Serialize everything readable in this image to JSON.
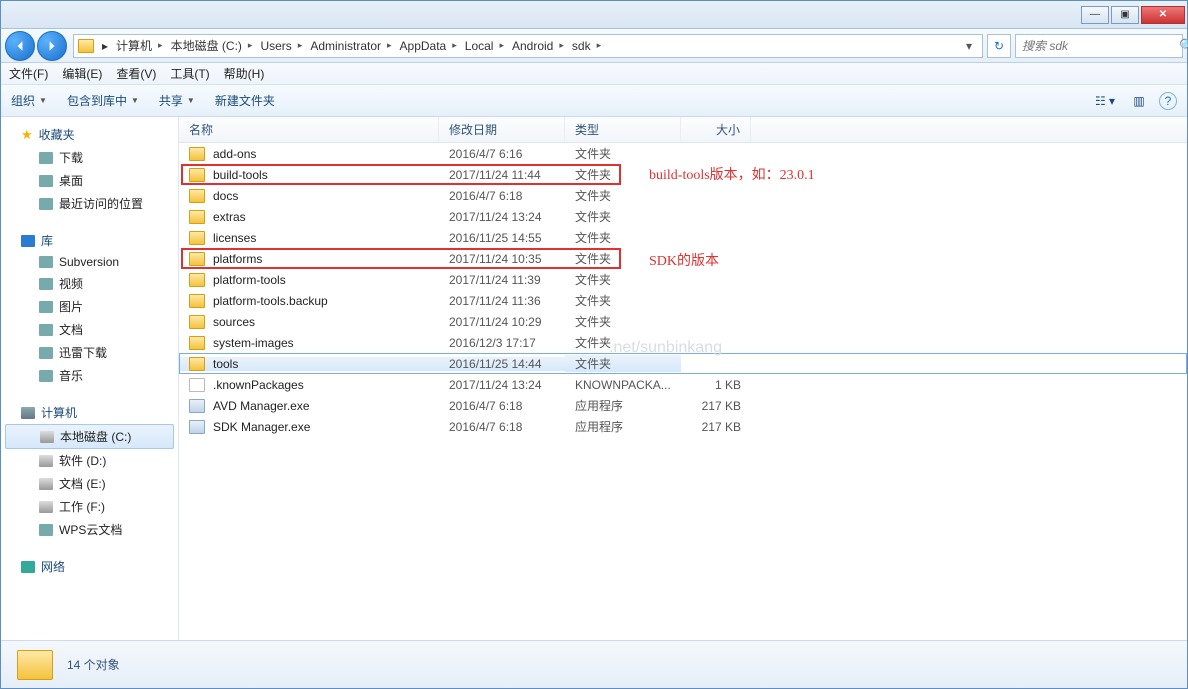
{
  "titlebar": {
    "min": "—",
    "max": "▣",
    "close": "✕"
  },
  "breadcrumb": [
    "计算机",
    "本地磁盘 (C:)",
    "Users",
    "Administrator",
    "AppData",
    "Local",
    "Android",
    "sdk"
  ],
  "search_placeholder": "搜索 sdk",
  "menubar": [
    "文件(F)",
    "编辑(E)",
    "查看(V)",
    "工具(T)",
    "帮助(H)"
  ],
  "toolbar": {
    "organize": "组织",
    "include": "包含到库中",
    "share": "共享",
    "newfolder": "新建文件夹"
  },
  "sidebar": {
    "favorites": {
      "label": "收藏夹",
      "items": [
        "下载",
        "桌面",
        "最近访问的位置"
      ]
    },
    "library": {
      "label": "库",
      "items": [
        "Subversion",
        "视频",
        "图片",
        "文档",
        "迅雷下载",
        "音乐"
      ]
    },
    "computer": {
      "label": "计算机",
      "items": [
        "本地磁盘 (C:)",
        "软件 (D:)",
        "文档 (E:)",
        "工作 (F:)",
        "WPS云文档"
      ],
      "selected": 0
    },
    "network": {
      "label": "网络"
    }
  },
  "columns": {
    "name": "名称",
    "date": "修改日期",
    "type": "类型",
    "size": "大小"
  },
  "files": [
    {
      "icon": "folder",
      "name": "add-ons",
      "date": "2016/4/7 6:16",
      "type": "文件夹",
      "size": ""
    },
    {
      "icon": "folder",
      "name": "build-tools",
      "date": "2017/11/24 11:44",
      "type": "文件夹",
      "size": ""
    },
    {
      "icon": "folder",
      "name": "docs",
      "date": "2016/4/7 6:18",
      "type": "文件夹",
      "size": ""
    },
    {
      "icon": "folder",
      "name": "extras",
      "date": "2017/11/24 13:24",
      "type": "文件夹",
      "size": ""
    },
    {
      "icon": "folder",
      "name": "licenses",
      "date": "2016/11/25 14:55",
      "type": "文件夹",
      "size": ""
    },
    {
      "icon": "folder",
      "name": "platforms",
      "date": "2017/11/24 10:35",
      "type": "文件夹",
      "size": ""
    },
    {
      "icon": "folder",
      "name": "platform-tools",
      "date": "2017/11/24 11:39",
      "type": "文件夹",
      "size": ""
    },
    {
      "icon": "folder",
      "name": "platform-tools.backup",
      "date": "2017/11/24 11:36",
      "type": "文件夹",
      "size": ""
    },
    {
      "icon": "folder",
      "name": "sources",
      "date": "2017/11/24 10:29",
      "type": "文件夹",
      "size": ""
    },
    {
      "icon": "folder",
      "name": "system-images",
      "date": "2016/12/3 17:17",
      "type": "文件夹",
      "size": ""
    },
    {
      "icon": "folder",
      "name": "tools",
      "date": "2016/11/25 14:44",
      "type": "文件夹",
      "size": "",
      "selected": true
    },
    {
      "icon": "file",
      "name": ".knownPackages",
      "date": "2017/11/24 13:24",
      "type": "KNOWNPACKA...",
      "size": "1 KB"
    },
    {
      "icon": "exe",
      "name": "AVD Manager.exe",
      "date": "2016/4/7 6:18",
      "type": "应用程序",
      "size": "217 KB"
    },
    {
      "icon": "exe",
      "name": "SDK Manager.exe",
      "date": "2016/4/7 6:18",
      "type": "应用程序",
      "size": "217 KB"
    }
  ],
  "annotations": {
    "a1": "build-tools版本，如：23.0.1",
    "a2": "SDK的版本"
  },
  "watermark": ".net/sunbinkang",
  "status": "14 个对象"
}
